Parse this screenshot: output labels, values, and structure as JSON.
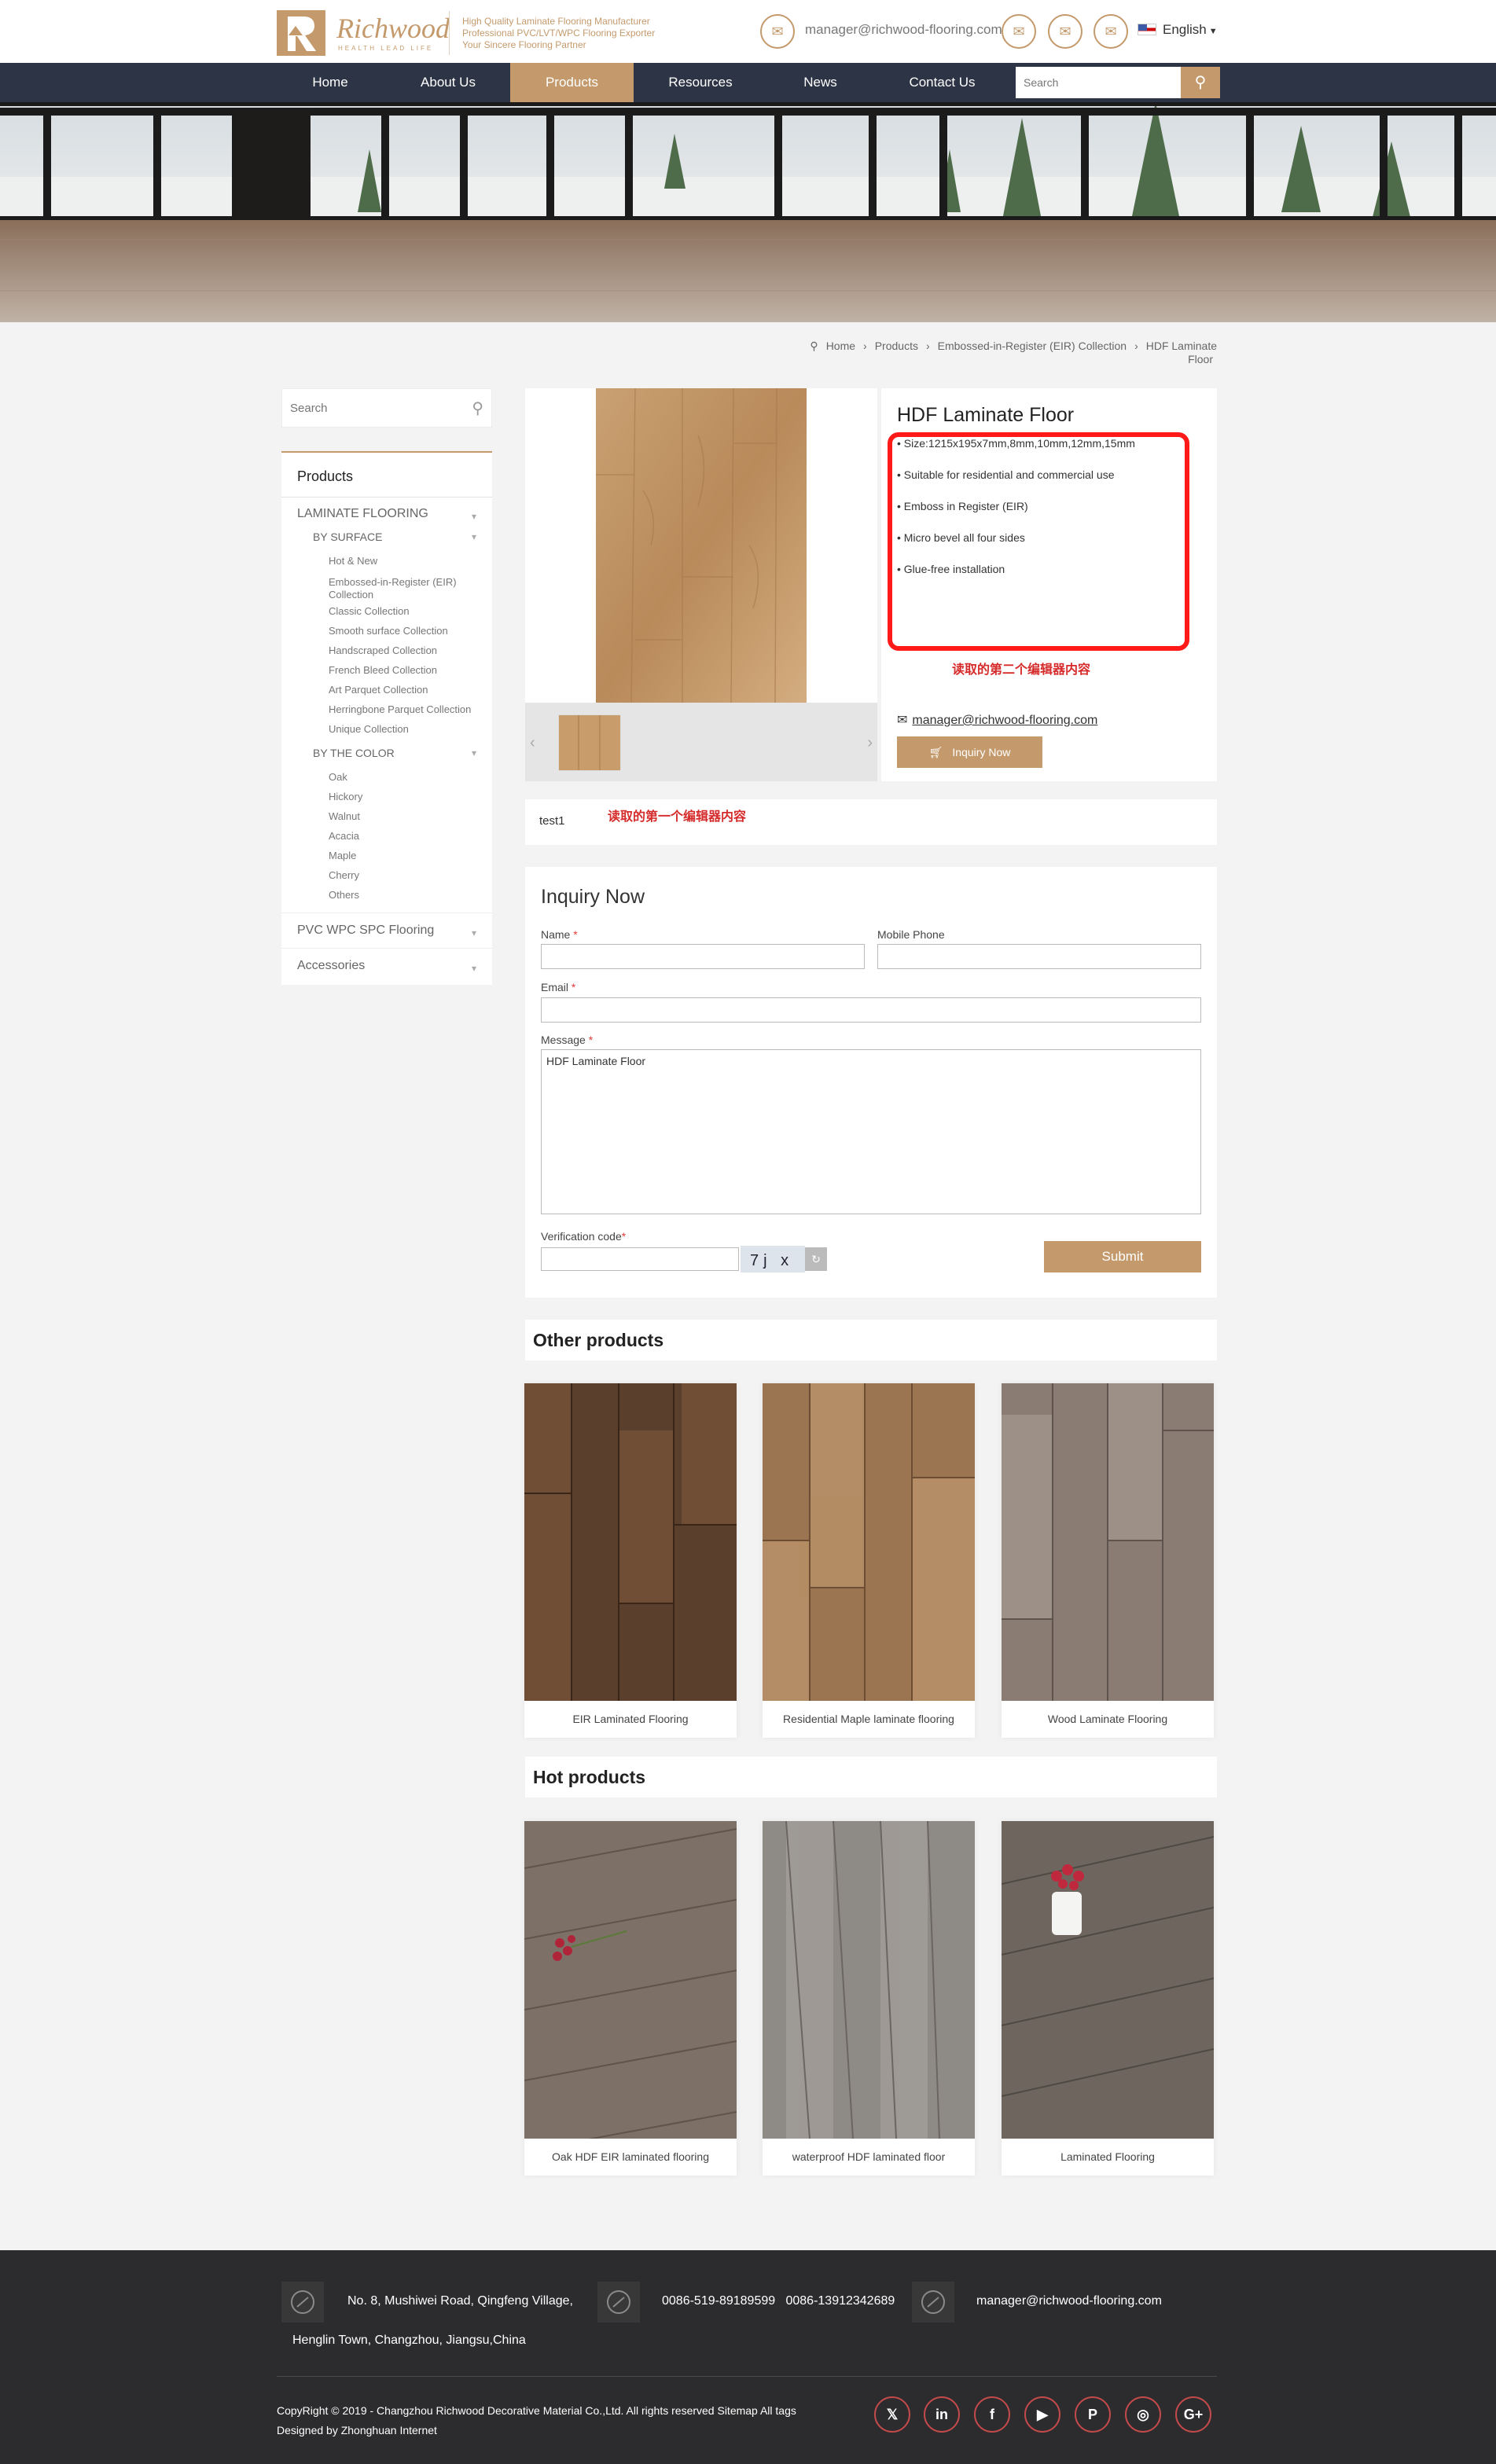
{
  "header": {
    "logo_letter": "R",
    "logo_name": "Richwood",
    "logo_sub": "HEALTH LEAD LIFE",
    "slogan": [
      "High Quality Laminate Flooring Manufacturer",
      "Professional PVC/LVT/WPC Flooring Exporter",
      "Your Sincere Flooring Partner"
    ],
    "email": "manager@richwood-flooring.com",
    "language": "English",
    "icons": [
      "mail-icon",
      "mail-icon",
      "mail-icon",
      "mail-icon"
    ]
  },
  "nav": {
    "items": [
      {
        "label": "Home",
        "active": false
      },
      {
        "label": "About Us",
        "active": false
      },
      {
        "label": "Products",
        "active": true
      },
      {
        "label": "Resources",
        "active": false
      },
      {
        "label": "News",
        "active": false
      },
      {
        "label": "Contact Us",
        "active": false
      }
    ],
    "search_placeholder": "Search"
  },
  "breadcrumb": [
    "Home",
    "Products",
    "Embossed-in-Register (EIR) Collection",
    "HDF Laminate Floor"
  ],
  "sidebar": {
    "search_placeholder": "Search",
    "title": "Products",
    "categories": [
      {
        "label": "LAMINATE FLOORING",
        "groups": [
          {
            "label": "BY SURFACE",
            "items": [
              "Hot & New",
              "Embossed-in-Register (EIR) Collection",
              "Classic Collection",
              "Smooth surface Collection",
              "Handscraped Collection",
              "French Bleed Collection",
              "Art Parquet Collection",
              "Herringbone Parquet Collection",
              "Unique Collection"
            ]
          },
          {
            "label": "BY THE COLOR",
            "items": [
              "Oak",
              "Hickory",
              "Walnut",
              "Acacia",
              "Maple",
              "Cherry",
              "Others"
            ]
          }
        ]
      },
      {
        "label": "PVC WPC SPC Flooring"
      },
      {
        "label": "Accessories"
      }
    ]
  },
  "product": {
    "title": "HDF Laminate Floor",
    "features": [
      "• Size:1215x195x7mm,8mm,10mm,12mm,15mm",
      "• Suitable for residential and commercial use",
      "• Emboss in Register (EIR)",
      "• Micro bevel all four sides",
      "• Glue-free installation"
    ],
    "editor2_note": "读取的第二个编辑器内容",
    "email": "manager@richwood-flooring.com",
    "inquiry_button": "Inquiry Now",
    "highlight_color": "#ff1a1a"
  },
  "description": {
    "text": "test1",
    "editor1_note": "读取的第一个编辑器内容"
  },
  "form": {
    "title": "Inquiry Now",
    "name_label": "Name",
    "mobile_label": "Mobile Phone",
    "email_label": "Email",
    "message_label": "Message",
    "message_value": "HDF Laminate Floor",
    "verification_label": "Verification code",
    "required_mark": "*",
    "captcha_text": "7j x",
    "submit_label": "Submit"
  },
  "other_products": {
    "title": "Other products",
    "items": [
      "EIR Laminated Flooring",
      "Residential Maple laminate flooring",
      "Wood Laminate Flooring"
    ]
  },
  "hot_products": {
    "title": "Hot products",
    "items": [
      "Oak HDF EIR laminated flooring",
      "waterproof HDF laminated floor",
      "Laminated Flooring"
    ]
  },
  "footer": {
    "address_line1": "No. 8, Mushiwei Road, Qingfeng Village,",
    "address_line2": "Henglin Town, Changzhou, Jiangsu,China",
    "phones": "0086-519-89189599   0086-13912342689",
    "email": "manager@richwood-flooring.com",
    "copyright": "CopyRight © 2019 -  Changzhou Richwood Decorative Material Co.,Ltd.  All rights reserved Sitemap  All tags",
    "designed_by": "Designed by Zhonghuan Internet",
    "social": [
      {
        "name": "twitter-icon",
        "glyph": "𝕏"
      },
      {
        "name": "linkedin-icon",
        "glyph": "in"
      },
      {
        "name": "facebook-icon",
        "glyph": "f"
      },
      {
        "name": "youtube-icon",
        "glyph": "▶"
      },
      {
        "name": "pinterest-icon",
        "glyph": "P"
      },
      {
        "name": "instagram-icon",
        "glyph": "◎"
      },
      {
        "name": "google-plus-icon",
        "glyph": "G+"
      }
    ]
  },
  "colors": {
    "accent": "#c49a6c",
    "nav": "#2d3445",
    "footer": "#2c2c2e",
    "note": "#d62b2b"
  }
}
